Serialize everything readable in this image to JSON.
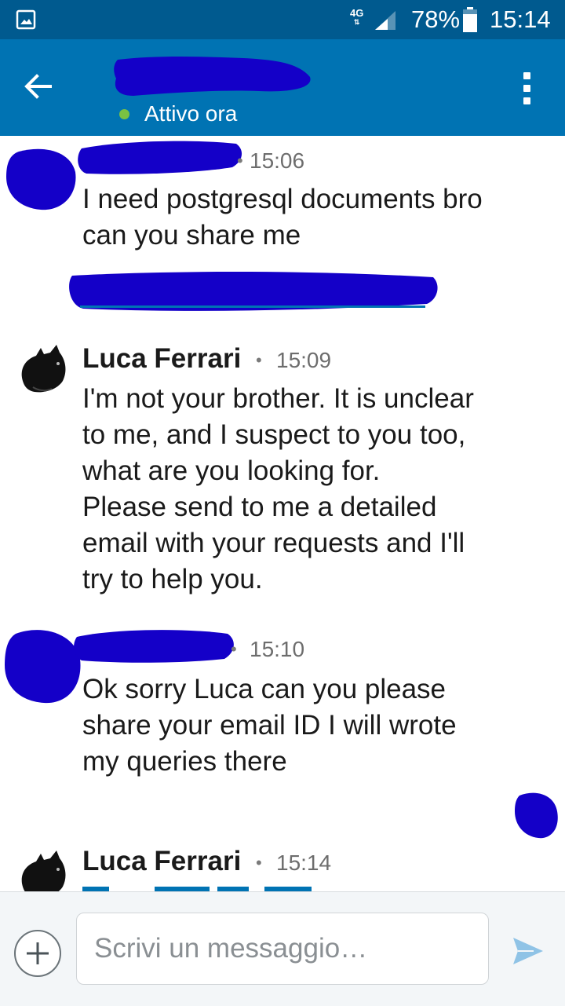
{
  "status_bar": {
    "network": "4G",
    "battery": "78%",
    "time": "15:14",
    "icons": [
      "gallery-icon",
      "signal-icon",
      "battery-icon"
    ]
  },
  "header": {
    "presence": "Attivo ora",
    "icons": [
      "back-arrow-icon",
      "overflow-menu-icon"
    ],
    "bar_color": "#0073b3",
    "status_color": "#005a8f",
    "presence_color": "#7ac142"
  },
  "messages": [
    {
      "time": "15:06",
      "text": "I need postgresql documents bro\ncan you share me"
    },
    {
      "sender": "Luca Ferrari",
      "separator": "•",
      "time": "15:09",
      "text": "I'm not your brother. It is unclear\nto me, and I suspect to you too,\nwhat are you looking for.\nPlease send to me a detailed\nemail with your requests and I'll\ntry to help you."
    },
    {
      "separator": "•",
      "time": "15:10",
      "text": "Ok sorry Luca can you please\nshare your email ID I will wrote\nmy queries there"
    },
    {
      "sender": "Luca Ferrari",
      "separator": "•",
      "time": "15:14"
    }
  ],
  "composer": {
    "placeholder": "Scrivi un messaggio…",
    "icons": [
      "plus-icon",
      "send-icon"
    ]
  },
  "redaction_color": "#1400c8",
  "link_color": "#0073b3"
}
